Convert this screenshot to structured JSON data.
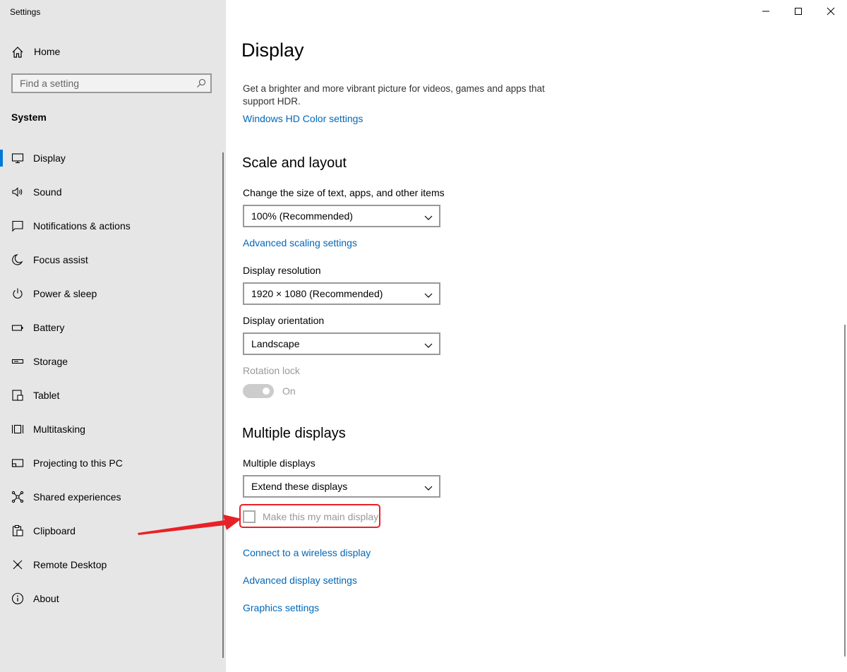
{
  "window": {
    "title": "Settings",
    "controls": [
      "minimize-icon",
      "maximize-icon",
      "close-icon"
    ]
  },
  "sidebar": {
    "home_label": "Home",
    "search_placeholder": "Find a setting",
    "section_title": "System",
    "selected_item": "Display",
    "accent_color": "#0078d7",
    "items": [
      {
        "label": "Display",
        "icon": "monitor-icon"
      },
      {
        "label": "Sound",
        "icon": "speaker-icon"
      },
      {
        "label": "Notifications & actions",
        "icon": "notification-icon"
      },
      {
        "label": "Focus assist",
        "icon": "moon-icon"
      },
      {
        "label": "Power & sleep",
        "icon": "power-icon"
      },
      {
        "label": "Battery",
        "icon": "battery-icon"
      },
      {
        "label": "Storage",
        "icon": "storage-icon"
      },
      {
        "label": "Tablet",
        "icon": "tablet-icon"
      },
      {
        "label": "Multitasking",
        "icon": "multitasking-icon"
      },
      {
        "label": "Projecting to this PC",
        "icon": "projector-icon"
      },
      {
        "label": "Shared experiences",
        "icon": "share-icon"
      },
      {
        "label": "Clipboard",
        "icon": "clipboard-icon"
      },
      {
        "label": "Remote Desktop",
        "icon": "remote-desktop-icon"
      },
      {
        "label": "About",
        "icon": "info-icon"
      }
    ]
  },
  "main": {
    "title": "Display",
    "hdr_description": "Get a brighter and more vibrant picture for videos, games and apps that support HDR.",
    "hdr_link": "Windows HD Color settings",
    "scale_section": {
      "heading": "Scale and layout",
      "scale_label": "Change the size of text, apps, and other items",
      "scale_value": "100% (Recommended)",
      "advanced_scaling_link": "Advanced scaling settings",
      "resolution_label": "Display resolution",
      "resolution_value": "1920 × 1080 (Recommended)",
      "orientation_label": "Display orientation",
      "orientation_value": "Landscape",
      "rotation_lock_label": "Rotation lock",
      "rotation_lock_state": "On"
    },
    "multiple_section": {
      "heading": "Multiple displays",
      "label": "Multiple displays",
      "value": "Extend these displays",
      "main_display_checkbox": "Make this my main display",
      "main_display_checked": false,
      "links": [
        "Connect to a wireless display",
        "Advanced display settings",
        "Graphics settings"
      ]
    },
    "link_color": "#0067b8",
    "annotation_color": "#e82127"
  }
}
